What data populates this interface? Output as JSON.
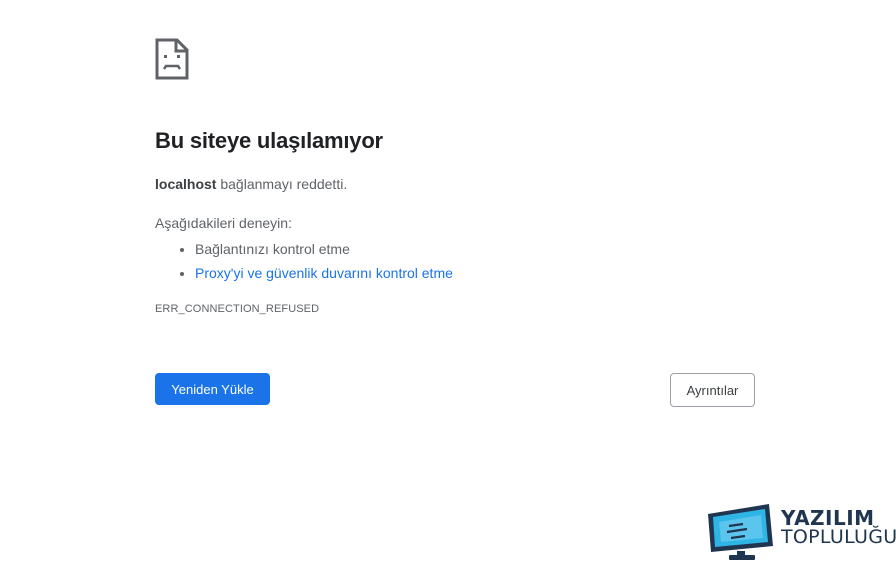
{
  "error_page": {
    "icon": "sad-page-icon",
    "heading": "Bu siteye ulaşılamıyor",
    "host": "localhost",
    "host_message": " bağlanmayı reddetti.",
    "suggestions_title": "Aşağıdakileri deneyin:",
    "suggestions": [
      {
        "label": "Bağlantınızı kontrol etme",
        "link": false
      },
      {
        "label": "Proxy'yi ve güvenlik duvarını kontrol etme",
        "link": true
      }
    ],
    "error_code": "ERR_CONNECTION_REFUSED",
    "reload_label": "Yeniden Yükle",
    "details_label": "Ayrıntılar"
  },
  "watermark": {
    "line1": "YAZILIM",
    "line2": "TOPLULUĞU"
  },
  "colors": {
    "primary": "#1a73e8",
    "text": "#202124",
    "secondary_text": "#5f6368"
  }
}
